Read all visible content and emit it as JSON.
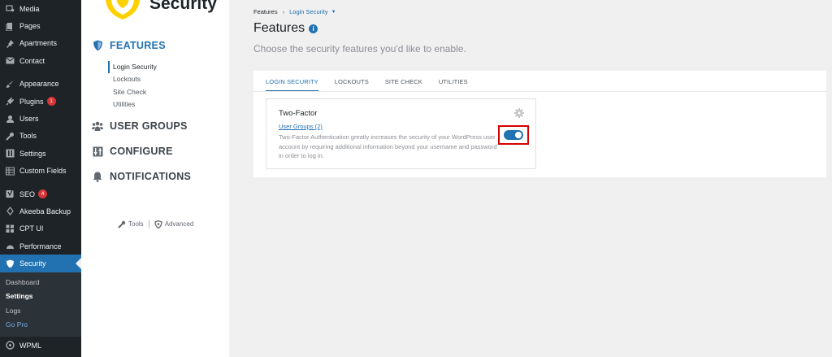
{
  "wp_menu": {
    "items": [
      {
        "label": "Media",
        "icon": "media-icon"
      },
      {
        "label": "Pages",
        "icon": "pages-icon"
      },
      {
        "label": "Apartments",
        "icon": "pin-icon"
      },
      {
        "label": "Contact",
        "icon": "mail-icon"
      },
      {
        "label": "Appearance",
        "icon": "brush-icon"
      },
      {
        "label": "Plugins",
        "icon": "plug-icon",
        "badge": "1"
      },
      {
        "label": "Users",
        "icon": "user-icon"
      },
      {
        "label": "Tools",
        "icon": "wrench-icon"
      },
      {
        "label": "Settings",
        "icon": "settings-icon"
      },
      {
        "label": "Custom Fields",
        "icon": "table-icon"
      },
      {
        "label": "SEO",
        "icon": "seo-icon",
        "badge": "4"
      },
      {
        "label": "Akeeba Backup",
        "icon": "akeeba-icon"
      },
      {
        "label": "CPT UI",
        "icon": "grid-icon"
      },
      {
        "label": "Performance",
        "icon": "performance-icon"
      },
      {
        "label": "Security",
        "icon": "shield-icon"
      },
      {
        "label": "WPML",
        "icon": "wpml-icon"
      }
    ],
    "security_submenu": [
      "Dashboard",
      "Settings",
      "Logs",
      "Go Pro"
    ]
  },
  "plugin_nav": {
    "logo_text": "Security",
    "features_label": "FEATURES",
    "features_items": [
      "Login Security",
      "Lockouts",
      "Site Check",
      "Utilities"
    ],
    "user_groups_label": "USER GROUPS",
    "configure_label": "CONFIGURE",
    "notifications_label": "NOTIFICATIONS",
    "footer": {
      "tools": "Tools",
      "advanced": "Advanced"
    }
  },
  "main": {
    "breadcrumb": {
      "root": "Features",
      "current": "Login Security"
    },
    "title": "Features",
    "subtitle": "Choose the security features you'd like to enable.",
    "tabs": [
      "LOGIN SECURITY",
      "LOCKOUTS",
      "SITE CHECK",
      "UTILITIES"
    ],
    "card": {
      "title": "Two-Factor",
      "link": "User Groups (2)",
      "description": "Two-Factor Authentication greatly increases the security of your WordPress user account by requiring additional information beyond your username and password in order to log in.",
      "toggle_enabled": true
    }
  },
  "colors": {
    "accent": "#2271b1",
    "sidebar": "#1d2327",
    "highlight": "#d80000"
  }
}
